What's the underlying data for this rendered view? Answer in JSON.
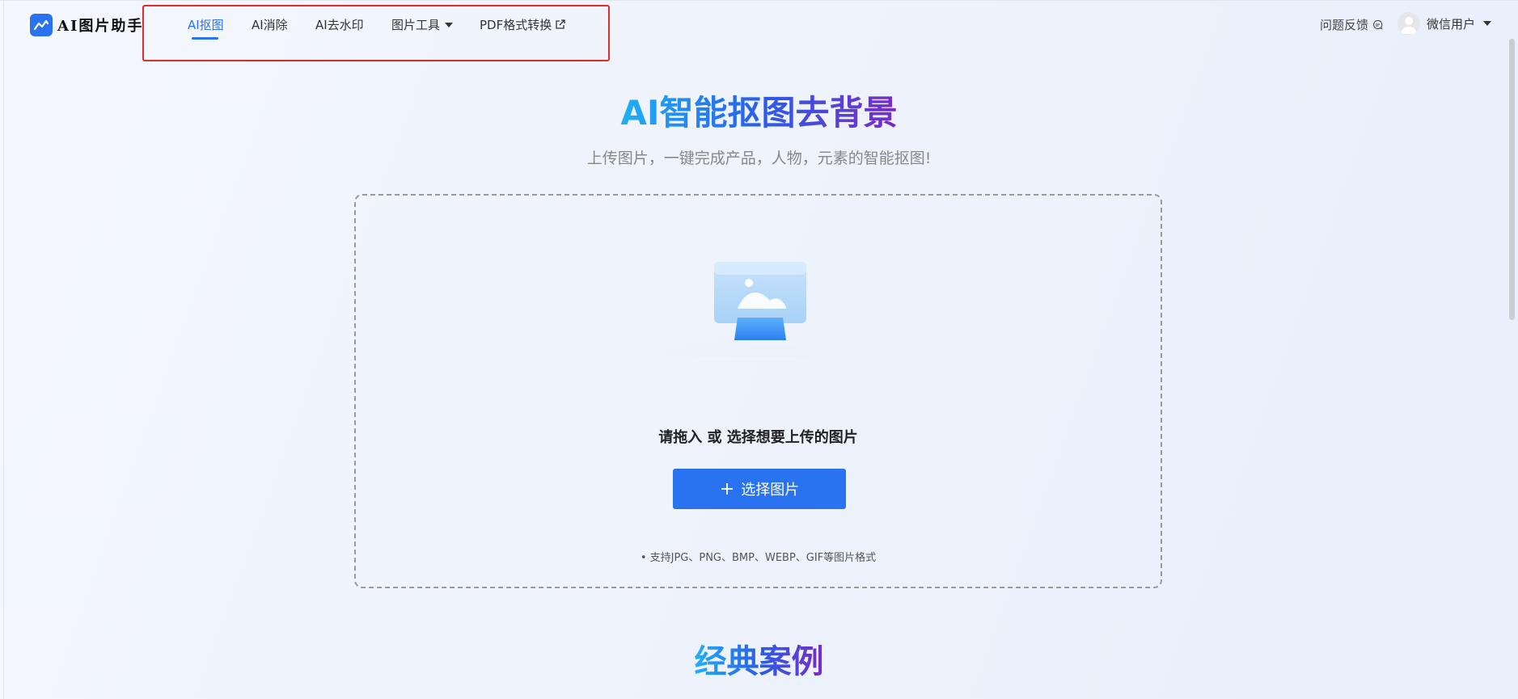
{
  "app": {
    "logo_text": "AI图片助手"
  },
  "nav": {
    "items": [
      {
        "label": "AI抠图",
        "active": true
      },
      {
        "label": "AI消除"
      },
      {
        "label": "AI去水印"
      },
      {
        "label": "图片工具",
        "has_dropdown": true
      },
      {
        "label": "PDF格式转换",
        "external": true
      }
    ]
  },
  "header": {
    "feedback_label": "问题反馈",
    "user_label": "微信用户"
  },
  "hero": {
    "title": "AI智能抠图去背景",
    "subtitle": "上传图片，一键完成产品，人物，元素的智能抠图!"
  },
  "upload": {
    "prompt": "请拖入 或 选择想要上传的图片",
    "button_label": "选择图片",
    "formats_note": "• 支持JPG、PNG、BMP、WEBP、GIF等图片格式"
  },
  "cases": {
    "title": "经典案例"
  },
  "colors": {
    "accent": "#2a73f0",
    "highlight_border": "#e02b2b",
    "title_gradient": [
      "#1fb0f5",
      "#2a5ee8",
      "#7a2ac8"
    ]
  },
  "icons": {
    "logo": "mountain-chart-icon",
    "feedback": "chat-bubble-icon",
    "avatar": "user-avatar-icon",
    "dropdown": "caret-down-icon",
    "external": "external-link-icon",
    "add": "plus-icon",
    "upload_illustration": "image-upload-illustration"
  }
}
